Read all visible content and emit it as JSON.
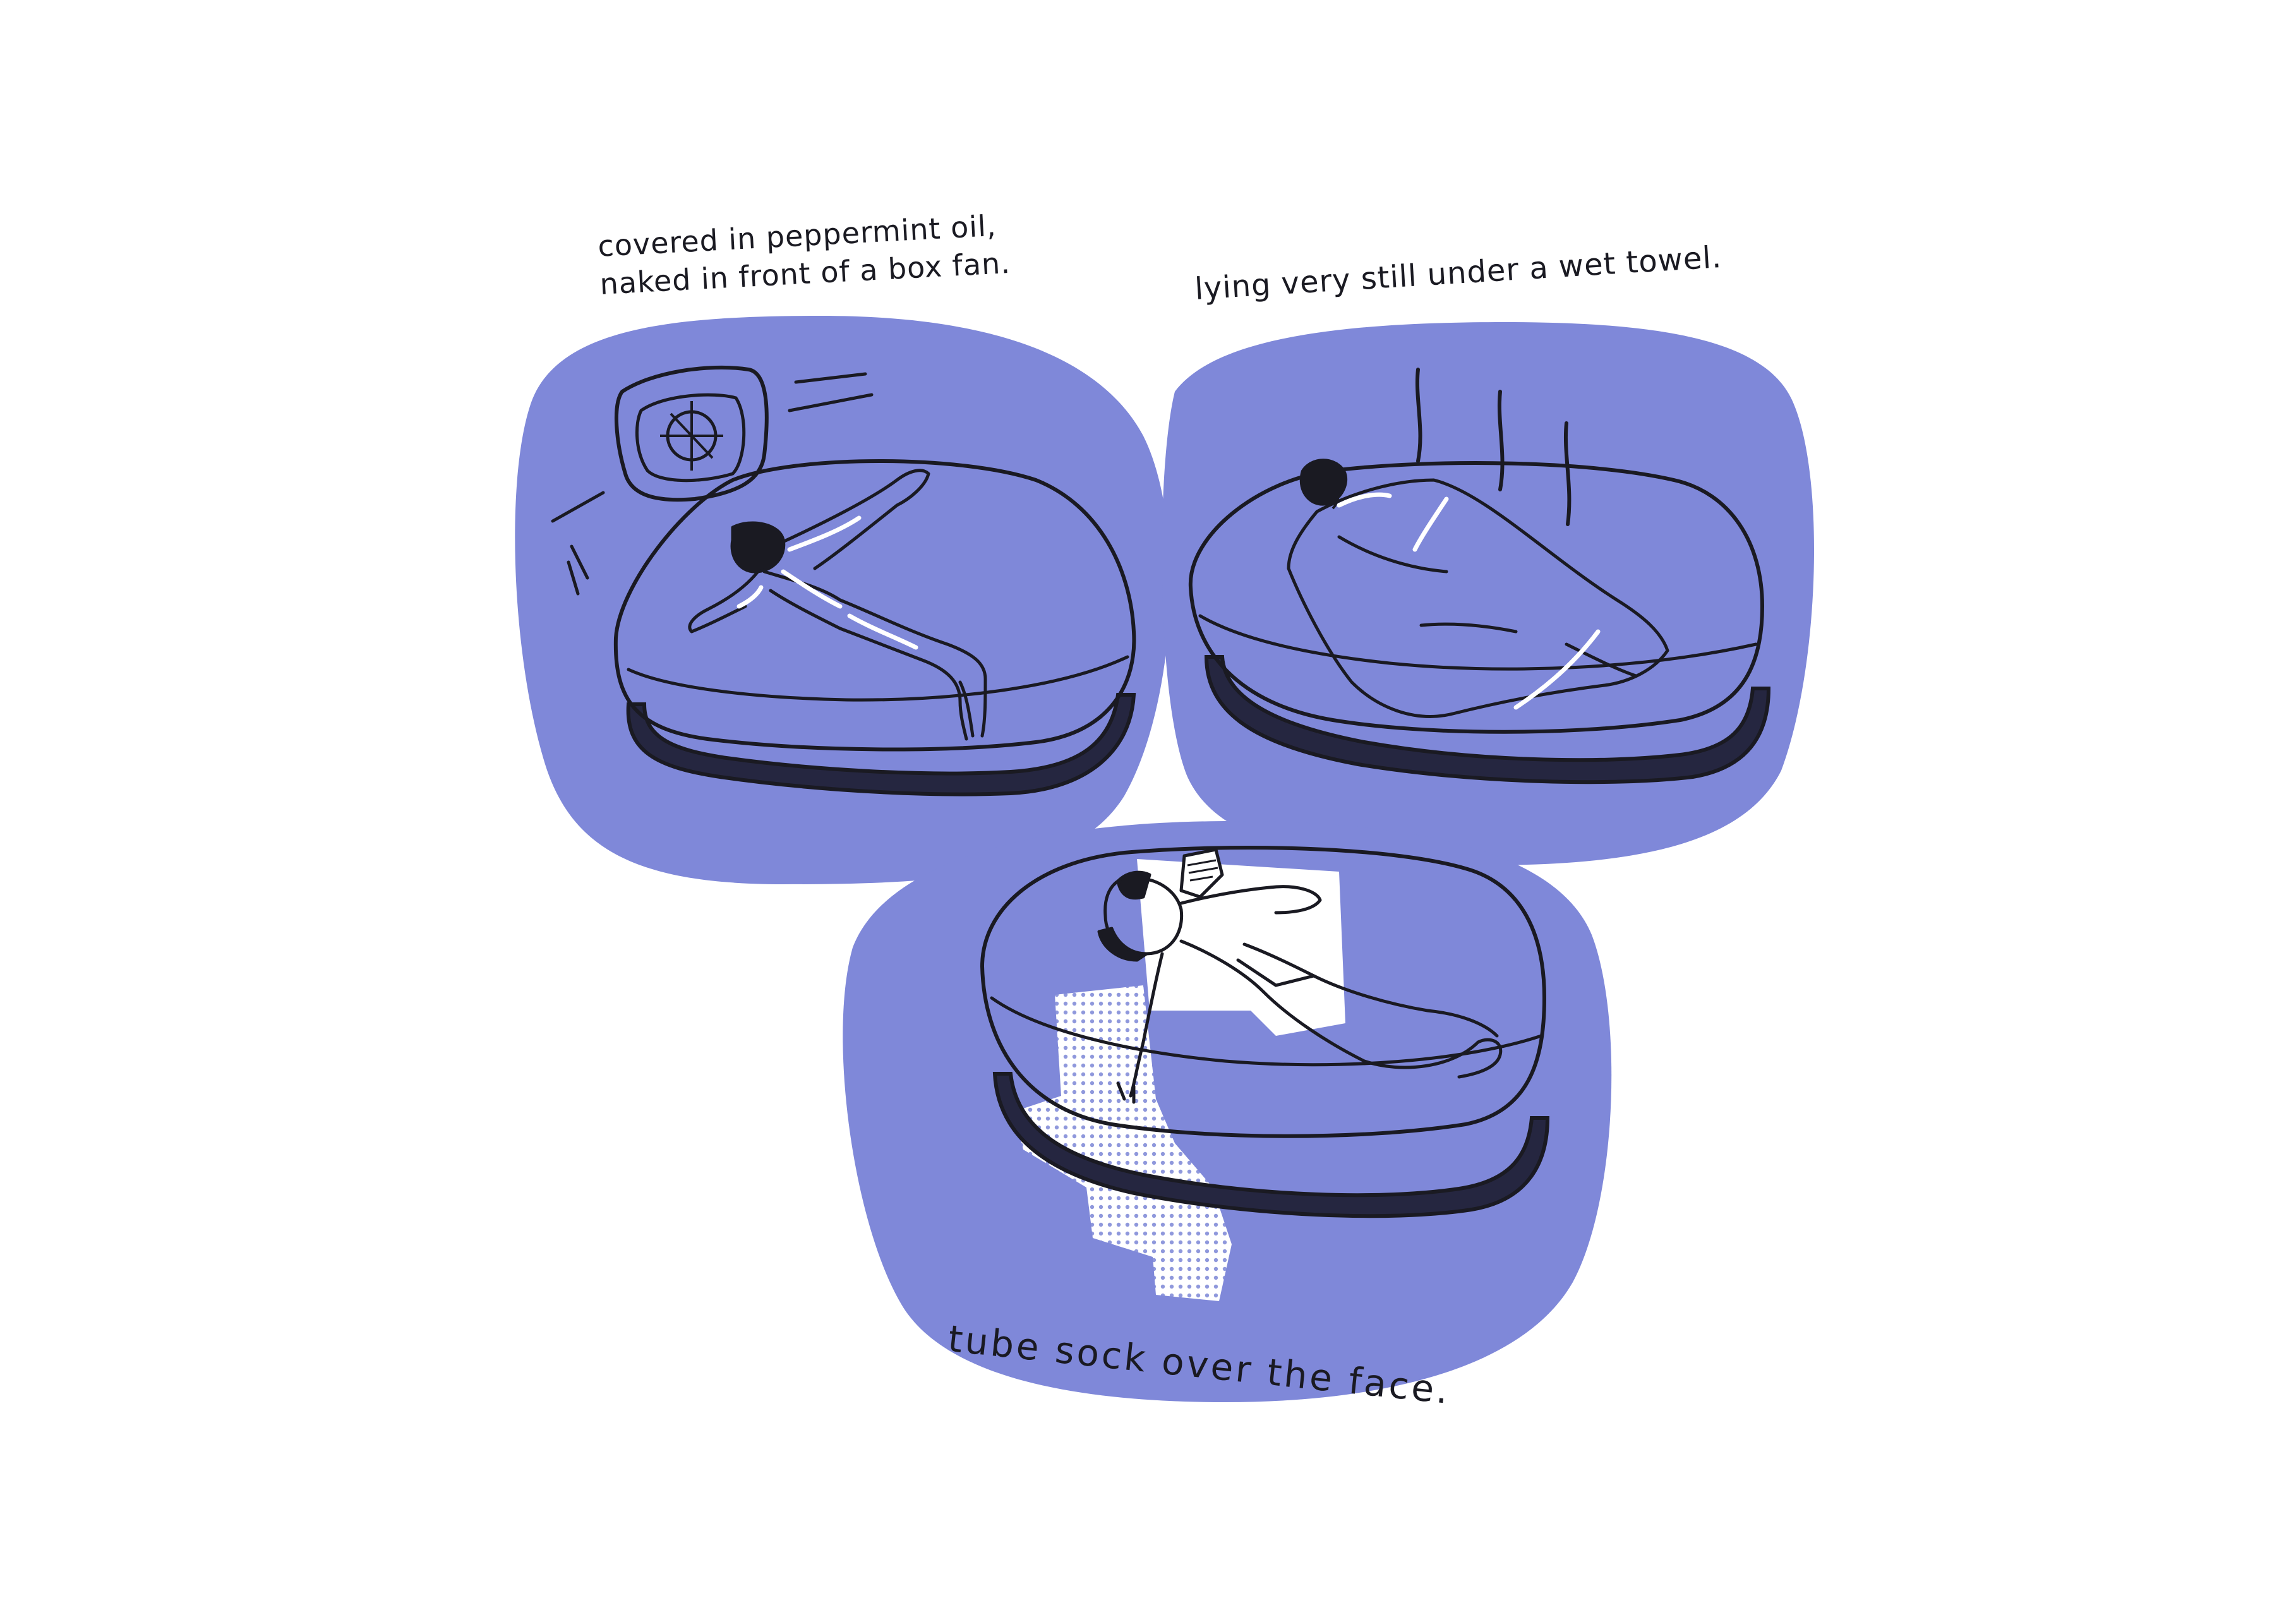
{
  "colors": {
    "background": "#ffffff",
    "blob": "#7f88d9",
    "ink": "#1a1a22",
    "mattress_base": "#252640",
    "highlight": "#ffffff",
    "stipple": "#c9cde9"
  },
  "panels": [
    {
      "caption_lines": [
        "covered in peppermint oil,",
        "naked in front of a box fan."
      ]
    },
    {
      "caption_lines": [
        "lying very still under a wet towel."
      ]
    },
    {
      "caption_lines": [
        "tube sock over the face."
      ]
    }
  ]
}
